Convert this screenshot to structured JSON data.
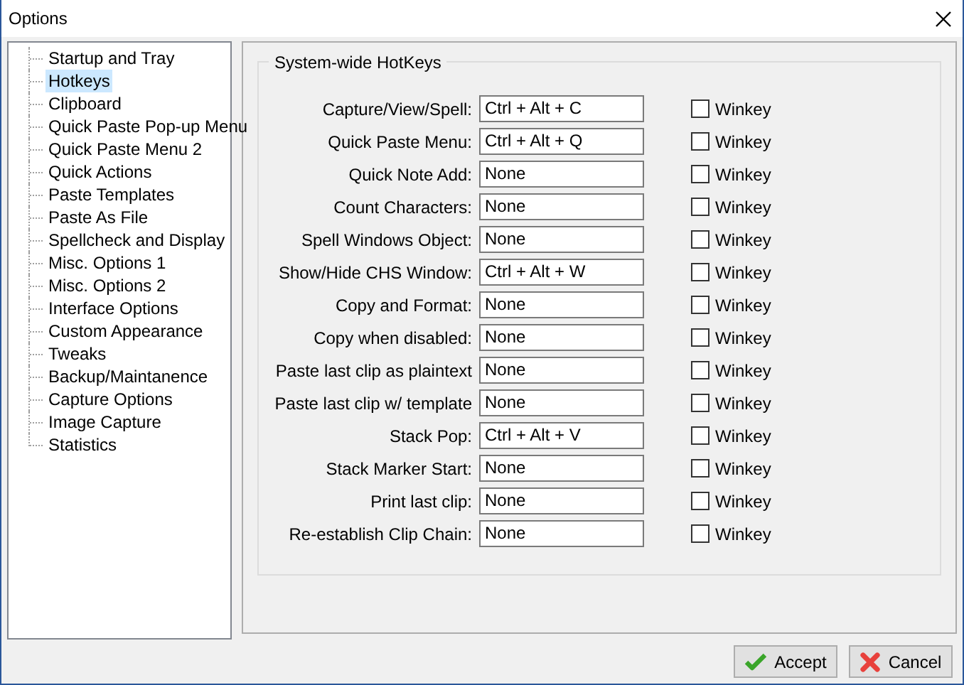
{
  "window": {
    "title": "Options"
  },
  "tree": {
    "items": [
      {
        "label": "Startup and Tray",
        "selected": false
      },
      {
        "label": "Hotkeys",
        "selected": true
      },
      {
        "label": "Clipboard",
        "selected": false
      },
      {
        "label": "Quick Paste Pop-up Menu",
        "selected": false
      },
      {
        "label": "Quick Paste Menu 2",
        "selected": false
      },
      {
        "label": "Quick Actions",
        "selected": false
      },
      {
        "label": "Paste Templates",
        "selected": false
      },
      {
        "label": "Paste As File",
        "selected": false
      },
      {
        "label": "Spellcheck and Display",
        "selected": false
      },
      {
        "label": "Misc. Options 1",
        "selected": false
      },
      {
        "label": "Misc. Options 2",
        "selected": false
      },
      {
        "label": "Interface Options",
        "selected": false
      },
      {
        "label": "Custom Appearance",
        "selected": false
      },
      {
        "label": "Tweaks",
        "selected": false
      },
      {
        "label": "Backup/Maintanence",
        "selected": false
      },
      {
        "label": "Capture Options",
        "selected": false
      },
      {
        "label": "Image Capture",
        "selected": false
      },
      {
        "label": "Statistics",
        "selected": false
      }
    ]
  },
  "group": {
    "title": "System-wide HotKeys",
    "hotkeys": [
      {
        "label": "Capture/View/Spell:",
        "value": "Ctrl + Alt + C",
        "winkey": {
          "label": "Winkey",
          "checked": false
        }
      },
      {
        "label": "Quick Paste Menu:",
        "value": "Ctrl + Alt + Q",
        "winkey": {
          "label": "Winkey",
          "checked": false
        }
      },
      {
        "label": "Quick Note Add:",
        "value": "None",
        "winkey": {
          "label": "Winkey",
          "checked": false
        }
      },
      {
        "label": "Count Characters:",
        "value": "None",
        "winkey": {
          "label": "Winkey",
          "checked": false
        }
      },
      {
        "label": "Spell Windows Object:",
        "value": "None",
        "winkey": {
          "label": "Winkey",
          "checked": false
        }
      },
      {
        "label": "Show/Hide CHS Window:",
        "value": "Ctrl + Alt + W",
        "winkey": {
          "label": "Winkey",
          "checked": false
        }
      },
      {
        "label": "Copy and Format:",
        "value": "None",
        "winkey": {
          "label": "Winkey",
          "checked": false
        }
      },
      {
        "label": "Copy when disabled:",
        "value": "None",
        "winkey": {
          "label": "Winkey",
          "checked": false
        }
      },
      {
        "label": "Paste last clip as plaintext",
        "value": "None",
        "winkey": {
          "label": "Winkey",
          "checked": false
        }
      },
      {
        "label": "Paste last clip w/ template",
        "value": "None",
        "winkey": {
          "label": "Winkey",
          "checked": false
        }
      },
      {
        "label": "Stack Pop:",
        "value": "Ctrl + Alt + V",
        "winkey": {
          "label": "Winkey",
          "checked": false
        }
      },
      {
        "label": "Stack Marker Start:",
        "value": "None",
        "winkey": {
          "label": "Winkey",
          "checked": false
        }
      },
      {
        "label": "Print last clip:",
        "value": "None",
        "winkey": {
          "label": "Winkey",
          "checked": false
        }
      },
      {
        "label": "Re-establish Clip Chain:",
        "value": "None",
        "winkey": {
          "label": "Winkey",
          "checked": false
        }
      }
    ]
  },
  "buttons": [
    {
      "label": "Accept",
      "kind": "accept"
    },
    {
      "label": "Cancel",
      "kind": "cancel"
    }
  ]
}
